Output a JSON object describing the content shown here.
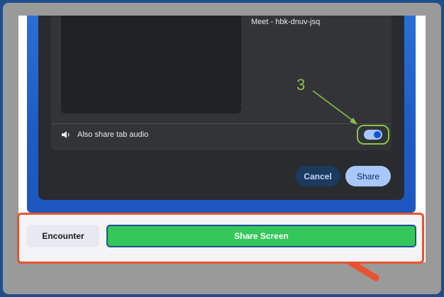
{
  "dialog": {
    "tab_title": "Meet - hbk-dnuv-jsq",
    "audio_option_label": "Also share tab audio",
    "audio_toggle_on": true,
    "cancel_label": "Cancel",
    "share_label": "Share"
  },
  "annotations": {
    "step_number": "3",
    "step_color": "#8bc34a",
    "highlight_color": "#e8532e"
  },
  "bottom_bar": {
    "encounter_label": "Encounter",
    "share_screen_label": "Share Screen",
    "share_screen_color": "#34c759"
  },
  "icons": {
    "speaker": "speaker-icon",
    "toggle": "toggle-switch"
  }
}
